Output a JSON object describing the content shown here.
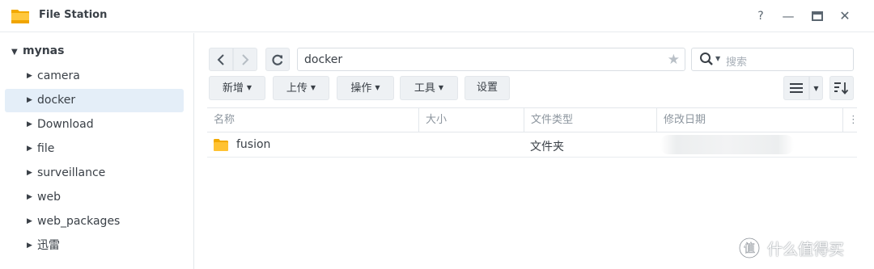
{
  "window": {
    "title": "File Station",
    "help_glyph": "?",
    "minimize_glyph": "—",
    "maximize_glyph": "▬",
    "close_glyph": "✕"
  },
  "sidebar": {
    "root": "mynas",
    "items": [
      {
        "label": "camera"
      },
      {
        "label": "docker",
        "selected": true
      },
      {
        "label": "Download"
      },
      {
        "label": "file"
      },
      {
        "label": "surveillance"
      },
      {
        "label": "web"
      },
      {
        "label": "web_packages"
      },
      {
        "label": "迅雷"
      }
    ]
  },
  "toolbar": {
    "path": "docker",
    "search_placeholder": "搜索",
    "new_label": "新增",
    "upload_label": "上传",
    "action_label": "操作",
    "tools_label": "工具",
    "settings_label": "设置"
  },
  "table": {
    "headers": {
      "name": "名称",
      "size": "大小",
      "type": "文件类型",
      "modified": "修改日期"
    },
    "rows": [
      {
        "name": "fusion",
        "size": "",
        "type": "文件夹",
        "modified": ""
      }
    ]
  },
  "watermark": {
    "text": "什么值得买"
  },
  "colors": {
    "accent_selected": "#e4eef8",
    "folder": "#f7b500",
    "button_bg": "#eef1f4"
  }
}
